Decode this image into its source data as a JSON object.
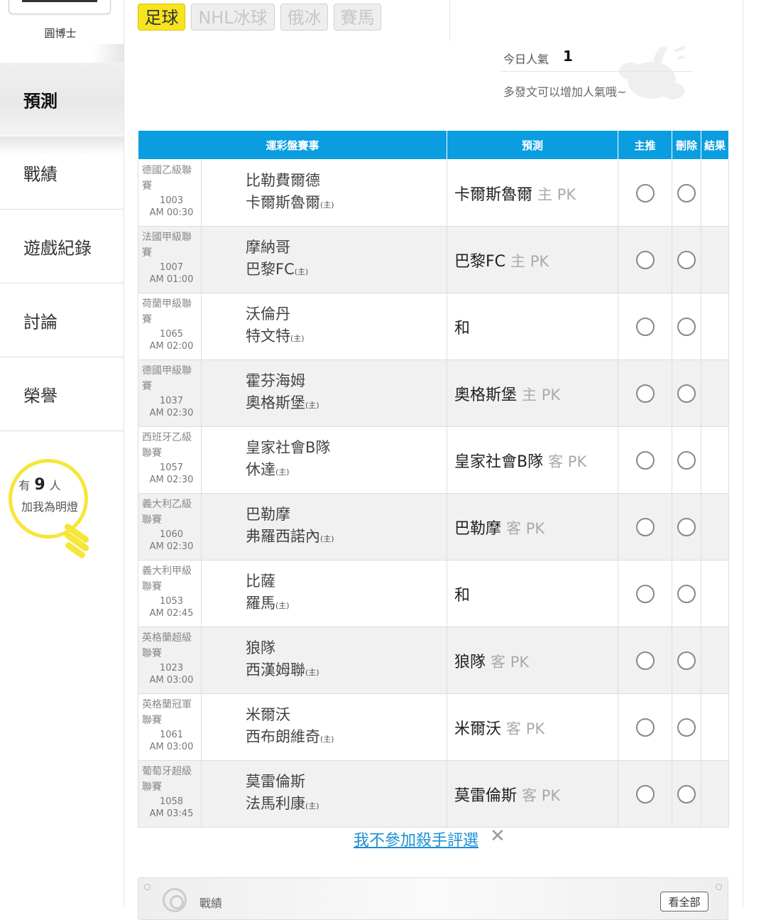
{
  "sidebar": {
    "user_name": "圓博士",
    "items": [
      {
        "label": "預測",
        "active": true
      },
      {
        "label": "戰績",
        "active": false
      },
      {
        "label": "遊戲紀錄",
        "active": false
      },
      {
        "label": "討論",
        "active": false
      },
      {
        "label": "榮譽",
        "active": false
      }
    ],
    "bulb": {
      "prefix": "有",
      "count": "9",
      "suffix": "人",
      "line2": "加我為明燈"
    }
  },
  "tabs": [
    {
      "label": "足球",
      "active": true
    },
    {
      "label": "NHL冰球",
      "active": false
    },
    {
      "label": "俄冰",
      "active": false
    },
    {
      "label": "賽馬",
      "active": false
    }
  ],
  "popularity": {
    "label": "今日人氣",
    "value": "1",
    "hint": "多發文可以增加人氣哦~"
  },
  "table": {
    "headers": {
      "event": "運彩盤賽事",
      "prediction": "預測",
      "main": "主推",
      "delete": "刪除",
      "result": "結果"
    },
    "home_mark": "(主)",
    "rows": [
      {
        "league": "德國乙級聯賽",
        "code": "1003",
        "time": "AM 00:30",
        "team1": "比勒費爾德",
        "team2": "卡爾斯魯爾",
        "pick": "卡爾斯魯爾",
        "pick_type": "主 PK"
      },
      {
        "league": "法國甲級聯賽",
        "code": "1007",
        "time": "AM 01:00",
        "team1": "摩納哥",
        "team2": "巴黎FC",
        "pick": "巴黎FC",
        "pick_type": "主 PK"
      },
      {
        "league": "荷蘭甲級聯賽",
        "code": "1065",
        "time": "AM 02:00",
        "team1": "沃倫丹",
        "team2": "特文特",
        "pick": "和",
        "pick_type": ""
      },
      {
        "league": "德國甲級聯賽",
        "code": "1037",
        "time": "AM 02:30",
        "team1": "霍芬海姆",
        "team2": "奧格斯堡",
        "pick": "奧格斯堡",
        "pick_type": "主 PK"
      },
      {
        "league": "西班牙乙級聯賽",
        "code": "1057",
        "time": "AM 02:30",
        "team1": "皇家社會B隊",
        "team2": "休達",
        "pick": "皇家社會B隊",
        "pick_type": "客 PK"
      },
      {
        "league": "義大利乙級聯賽",
        "code": "1060",
        "time": "AM 02:30",
        "team1": "巴勒摩",
        "team2": "弗羅西諾內",
        "pick": "巴勒摩",
        "pick_type": "客 PK"
      },
      {
        "league": "義大利甲級聯賽",
        "code": "1053",
        "time": "AM 02:45",
        "team1": "比薩",
        "team2": "羅馬",
        "pick": "和",
        "pick_type": ""
      },
      {
        "league": "英格蘭超級聯賽",
        "code": "1023",
        "time": "AM 03:00",
        "team1": "狼隊",
        "team2": "西漢姆聯",
        "pick": "狼隊",
        "pick_type": "客 PK"
      },
      {
        "league": "英格蘭冠軍聯賽",
        "code": "1061",
        "time": "AM 03:00",
        "team1": "米爾沃",
        "team2": "西布朗維奇",
        "pick": "米爾沃",
        "pick_type": "客 PK"
      },
      {
        "league": "葡萄牙超級聯賽",
        "code": "1058",
        "time": "AM 03:45",
        "team1": "莫雷倫斯",
        "team2": "法馬利康",
        "pick": "莫雷倫斯",
        "pick_type": "客 PK"
      }
    ]
  },
  "optout": {
    "label": "我不參加殺手評選",
    "close": "✕"
  },
  "record": {
    "label": "戰績",
    "see_all": "看全部"
  },
  "colors": {
    "accent_blue": "#0a9ee0",
    "tab_yellow": "#f6e41f",
    "bulb_yellow": "#f6e63a",
    "link_blue": "#1a8fd1"
  }
}
